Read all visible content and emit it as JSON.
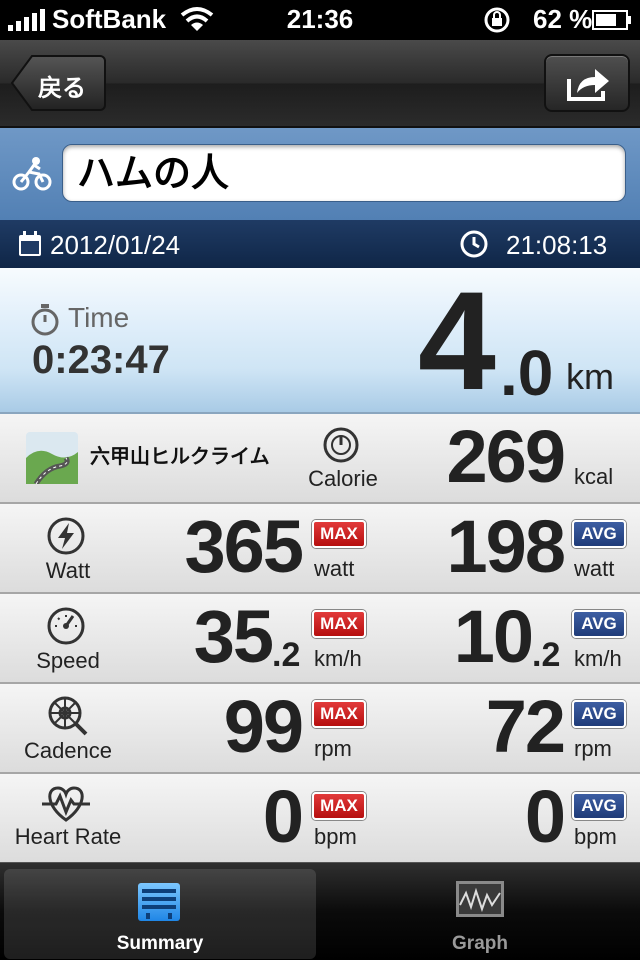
{
  "status_bar": {
    "carrier": "SoftBank",
    "time": "21:36",
    "battery": "62 %"
  },
  "nav": {
    "back_label": "戻る"
  },
  "ride": {
    "title": "ハムの人",
    "date": "2012/01/24",
    "start_time": "21:08:13",
    "time_label": "Time",
    "elapsed": "0:23:47",
    "distance_int": "4",
    "distance_dec": ".0",
    "distance_unit": "km"
  },
  "course": {
    "name": "六甲山ヒルクライム"
  },
  "calorie": {
    "label": "Calorie",
    "value": "269",
    "unit": "kcal"
  },
  "metrics": [
    {
      "label": "Watt",
      "max": "365",
      "max_dec": "",
      "max_unit": "watt",
      "avg": "198",
      "avg_dec": "",
      "avg_unit": "watt"
    },
    {
      "label": "Speed",
      "max": "35",
      "max_dec": ".2",
      "max_unit": "km/h",
      "avg": "10",
      "avg_dec": ".2",
      "avg_unit": "km/h"
    },
    {
      "label": "Cadence",
      "max": "99",
      "max_dec": "",
      "max_unit": "rpm",
      "avg": "72",
      "avg_dec": "",
      "avg_unit": "rpm"
    },
    {
      "label": "Heart Rate",
      "max": "0",
      "max_dec": "",
      "max_unit": "bpm",
      "avg": "0",
      "avg_dec": "",
      "avg_unit": "bpm"
    }
  ],
  "badges": {
    "max": "MAX",
    "avg": "AVG"
  },
  "tabs": [
    {
      "label": "Summary"
    },
    {
      "label": "Graph"
    }
  ],
  "colors": {
    "max_badge": "#c81d1d",
    "avg_badge": "#2a4a8e",
    "title_bar": "#5e8bbe",
    "date_bar": "#17325a"
  }
}
